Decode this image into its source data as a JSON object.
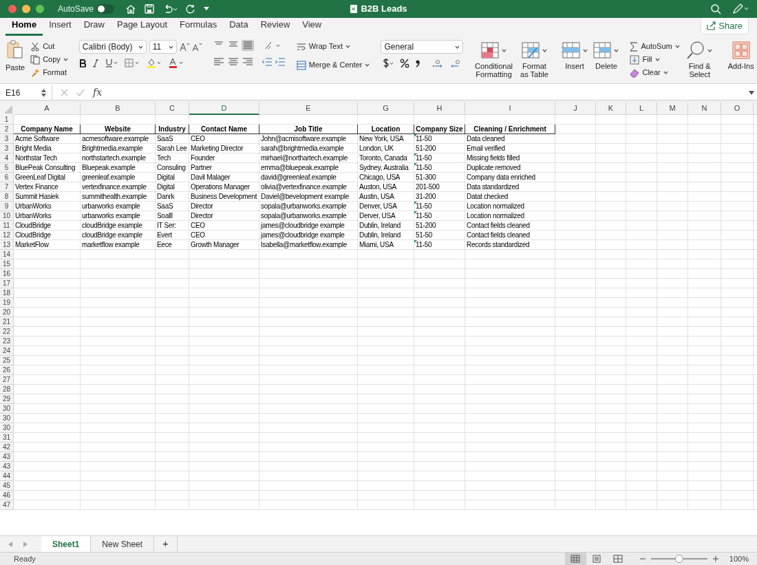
{
  "window": {
    "title": "B2B Leads",
    "autosave_label": "AutoSave",
    "autosave_on": false
  },
  "ribbon_tabs": [
    {
      "label": "Home",
      "selected": true
    },
    {
      "label": "Insert",
      "selected": false
    },
    {
      "label": "Draw",
      "selected": false
    },
    {
      "label": "Page Layout",
      "selected": false
    },
    {
      "label": "Formulas",
      "selected": false
    },
    {
      "label": "Data",
      "selected": false
    },
    {
      "label": "Review",
      "selected": false
    },
    {
      "label": "View",
      "selected": false
    }
  ],
  "share_label": "Share",
  "ribbon": {
    "paste": "Paste",
    "cut": "Cut",
    "copy": "Copy",
    "format": "Format",
    "font_name": "Calibri (Body)",
    "font_size": "11",
    "bottom_align_selected": true,
    "wrap_text": "Wrap Text",
    "merge_center": "Merge & Center",
    "number_format": "General",
    "conditional_formatting": "Conditional Formatting",
    "format_as_table": "Format as Table",
    "insert": "Insert",
    "delete": "Delete",
    "autosum": "AutoSum",
    "fill": "Fill",
    "clear": "Clear",
    "find_select": "Find & Select",
    "add_ins": "Add-Ins"
  },
  "formula_bar": {
    "name_box": "E16",
    "fx": "fx"
  },
  "columns": [
    {
      "letter": "A",
      "selected": false
    },
    {
      "letter": "B",
      "selected": false
    },
    {
      "letter": "C",
      "selected": false
    },
    {
      "letter": "D",
      "selected": true
    },
    {
      "letter": "E",
      "selected": false
    },
    {
      "letter": "G",
      "selected": false
    },
    {
      "letter": "H",
      "selected": false
    },
    {
      "letter": "I",
      "selected": false
    },
    {
      "letter": "J",
      "selected": false
    },
    {
      "letter": "K",
      "selected": false
    },
    {
      "letter": "L",
      "selected": false
    },
    {
      "letter": "M",
      "selected": false
    },
    {
      "letter": "N",
      "selected": false
    },
    {
      "letter": "O",
      "selected": false
    }
  ],
  "rows": [
    {
      "number": "1",
      "kind": "blank"
    },
    {
      "number": "2",
      "kind": "header",
      "cells": [
        "Company Name",
        "Website",
        "Industry",
        "Contact Name",
        "Job Title",
        "Location",
        "Company Size",
        "Cleaning / Enrichment"
      ]
    },
    {
      "number": "3",
      "kind": "data",
      "flagged": true,
      "cells": [
        "Acme Software",
        "acmesoftware.example",
        "SaaS",
        "CEO",
        "John@acmisoftware.example",
        "New York, USA",
        "11-50",
        "Data cleaned"
      ]
    },
    {
      "number": "3",
      "kind": "data",
      "flagged": false,
      "cells": [
        "Bright Media",
        "Brightmedia.example",
        "Sarah Lee",
        "Marketing Director",
        "sarah@brightmedia.example",
        "London, UK",
        "51-200",
        "Email verified"
      ]
    },
    {
      "number": "4",
      "kind": "data",
      "flagged": true,
      "cells": [
        "Northstar Tech",
        "northstartech.example",
        "Tech",
        "Founder",
        "mirhael@northartech.example",
        "Toronto, Canada",
        "11-50",
        "Missing fields filled"
      ]
    },
    {
      "number": "5",
      "kind": "data",
      "flagged": true,
      "cells": [
        "BluePeak Consulting",
        "Bluepeak.example",
        "Consuling",
        "Partner",
        "emma@bluepeak.example",
        "Sydney, Australia",
        "11-50",
        "Duplicate removed"
      ]
    },
    {
      "number": "6",
      "kind": "data",
      "flagged": false,
      "cells": [
        "GreenLeaf Digital",
        "greenleaf.example",
        "Digital",
        "Davil Malager",
        "david@greenleaf.example",
        "Chicago, USA",
        "51-300",
        "Company data enriched"
      ]
    },
    {
      "number": "7",
      "kind": "data",
      "flagged": false,
      "cells": [
        "Vertex Finance",
        "vertexfinance.example",
        "Digital",
        "Operations Manager",
        "olivia@vertexfinance.example",
        "Auston, USA",
        "201-500",
        "Data standardized"
      ]
    },
    {
      "number": "8",
      "kind": "data",
      "flagged": false,
      "cells": [
        "Summit Hasiek",
        "summithealth.example",
        "Danrk",
        "Business Development",
        "Daviel@bevelopment example",
        "Austin, USA",
        "31-200",
        "Datat checked"
      ]
    },
    {
      "number": "9",
      "kind": "data",
      "flagged": true,
      "cells": [
        "UrbanWorks",
        "urbarworks example",
        "SaaS",
        "Director",
        "sopala@urbanworks.example",
        "Denver, USA",
        "11-50",
        "Location normalized"
      ]
    },
    {
      "number": "10",
      "kind": "data",
      "flagged": true,
      "cells": [
        "UrbanWorks",
        "urbarworks example",
        "Soalll",
        "Director",
        "sopala@urbanworks.example",
        "Derver, USA",
        "11-50",
        "Location normalized"
      ]
    },
    {
      "number": "11",
      "kind": "data",
      "flagged": false,
      "cells": [
        "CloudBridge",
        "cloudBridge example",
        "IT Ser:",
        "CEO",
        "james@cloudbridge example",
        "Dublin, Ireland",
        "51-200",
        "Contact fields cleaned"
      ]
    },
    {
      "number": "12",
      "kind": "data",
      "flagged": false,
      "cells": [
        "CloudBridge",
        "cloudBridge example",
        "Evert",
        "CEO",
        "james@cloudbridge example",
        "Dublin, Ireland",
        "51-50",
        "Contact fields cleaned"
      ]
    },
    {
      "number": "13",
      "kind": "data",
      "flagged": true,
      "cells": [
        "MarketFlow",
        "marketflow example",
        "Eece",
        "Growth Manager",
        "Isabella@marketflow.example",
        "Miami, USA",
        "11-50",
        "Records standardized"
      ]
    },
    {
      "number": "14",
      "kind": "blank"
    },
    {
      "number": "15",
      "kind": "blank"
    },
    {
      "number": "16",
      "kind": "blank"
    },
    {
      "number": "17",
      "kind": "blank"
    },
    {
      "number": "18",
      "kind": "blank"
    },
    {
      "number": "19",
      "kind": "blank"
    },
    {
      "number": "20",
      "kind": "blank"
    },
    {
      "number": "21",
      "kind": "blank"
    },
    {
      "number": "22",
      "kind": "blank"
    },
    {
      "number": "23",
      "kind": "blank"
    },
    {
      "number": "24",
      "kind": "blank"
    },
    {
      "number": "25",
      "kind": "blank"
    },
    {
      "number": "26",
      "kind": "blank"
    },
    {
      "number": "27",
      "kind": "blank"
    },
    {
      "number": "28",
      "kind": "blank"
    },
    {
      "number": "29",
      "kind": "blank"
    },
    {
      "number": "30",
      "kind": "blank"
    },
    {
      "number": "30",
      "kind": "blank"
    },
    {
      "number": "30",
      "kind": "blank"
    },
    {
      "number": "31",
      "kind": "blank"
    },
    {
      "number": "42",
      "kind": "blank"
    },
    {
      "number": "43",
      "kind": "blank"
    },
    {
      "number": "43",
      "kind": "blank"
    },
    {
      "number": "44",
      "kind": "blank"
    },
    {
      "number": "45",
      "kind": "blank"
    },
    {
      "number": "46",
      "kind": "blank"
    },
    {
      "number": "47",
      "kind": "blank"
    }
  ],
  "sheet_tabs": [
    {
      "label": "Sheet1",
      "selected": true
    },
    {
      "label": "New Sheet",
      "selected": false
    }
  ],
  "add_sheet": "+",
  "status_bar": {
    "status": "Ready",
    "views": [
      {
        "selected": true
      },
      {
        "selected": false
      },
      {
        "selected": false
      }
    ],
    "zoom_slider": {
      "level": 0.5
    },
    "zoom": "100%"
  }
}
